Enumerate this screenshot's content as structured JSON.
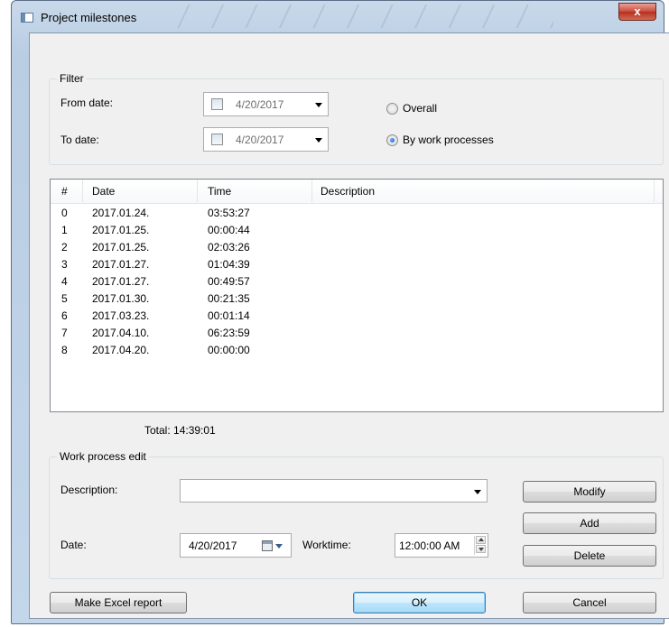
{
  "window": {
    "title": "Project milestones",
    "close_glyph": "x"
  },
  "filter": {
    "group_title": "Filter",
    "from_label": "From date:",
    "from_value": "4/20/2017",
    "to_label": "To date:",
    "to_value": "4/20/2017",
    "radio_overall": "Overall",
    "radio_by_work": "By work processes",
    "selected": "By work processes"
  },
  "list": {
    "columns": [
      "#",
      "Date",
      "Time",
      "Description"
    ],
    "rows": [
      {
        "n": "0",
        "date": "2017.01.24.",
        "time": "03:53:27",
        "desc": ""
      },
      {
        "n": "1",
        "date": "2017.01.25.",
        "time": "00:00:44",
        "desc": ""
      },
      {
        "n": "2",
        "date": "2017.01.25.",
        "time": "02:03:26",
        "desc": ""
      },
      {
        "n": "3",
        "date": "2017.01.27.",
        "time": "01:04:39",
        "desc": ""
      },
      {
        "n": "4",
        "date": "2017.01.27.",
        "time": "00:49:57",
        "desc": ""
      },
      {
        "n": "5",
        "date": "2017.01.30.",
        "time": "00:21:35",
        "desc": ""
      },
      {
        "n": "6",
        "date": "2017.03.23.",
        "time": "00:01:14",
        "desc": ""
      },
      {
        "n": "7",
        "date": "2017.04.10.",
        "time": "06:23:59",
        "desc": ""
      },
      {
        "n": "8",
        "date": "2017.04.20.",
        "time": "00:00:00",
        "desc": ""
      }
    ],
    "total": "Total: 14:39:01"
  },
  "edit": {
    "group_title": "Work process edit",
    "description_label": "Description:",
    "description_value": "",
    "date_label": "Date:",
    "date_value": "4/20/2017",
    "worktime_label": "Worktime:",
    "worktime_value": "12:00:00 AM",
    "modify": "Modify",
    "add": "Add",
    "delete": "Delete"
  },
  "footer": {
    "excel": "Make Excel report",
    "ok": "OK",
    "cancel": "Cancel"
  },
  "icons": {
    "calendar": "calendar-icon",
    "dropdown": "chevron-down-icon",
    "app": "window-app-icon"
  }
}
